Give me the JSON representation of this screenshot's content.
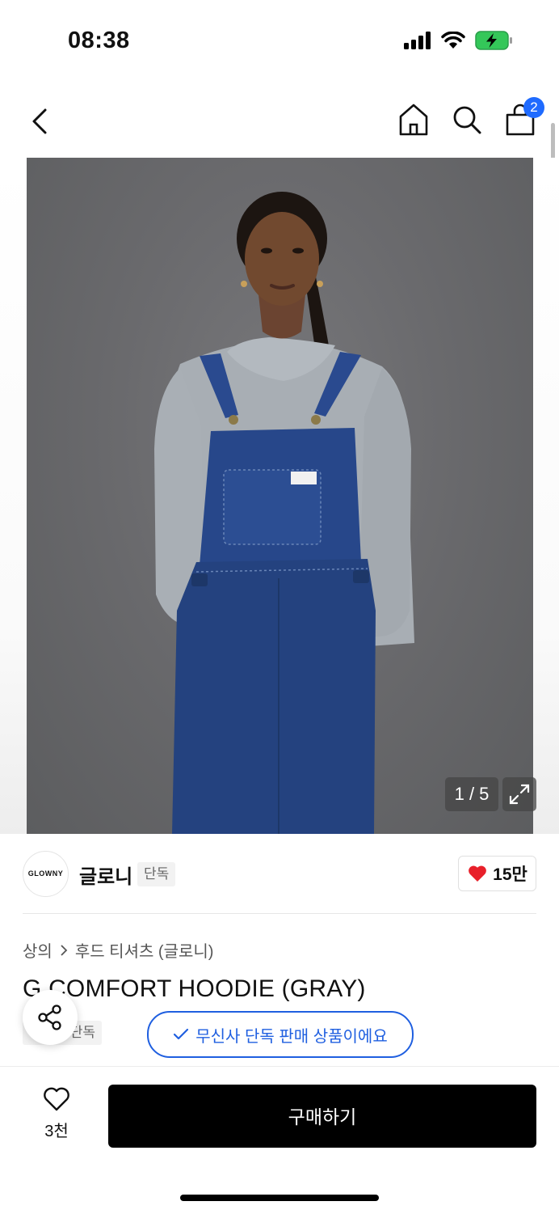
{
  "status_bar": {
    "time": "08:38"
  },
  "nav": {
    "cart_count": "2"
  },
  "gallery": {
    "counter": "1 / 5"
  },
  "brand": {
    "logo_text": "GLOWNY",
    "name": "글로니",
    "badge": "단독",
    "likes": "15만"
  },
  "breadcrumb": {
    "category": "상의",
    "subcategory": "후드 티셔츠 (글로니)"
  },
  "product": {
    "title": "G COMFORT HOODIE (GRAY)",
    "chip": "단독",
    "exclusive_message": "무신사 단독 판매 상품이에요"
  },
  "bottom_bar": {
    "wish_count": "3천",
    "buy_label": "구매하기"
  },
  "colors": {
    "accent_blue": "#1f5fe0",
    "badge_blue": "#1f6bff",
    "heart_red": "#e8202a"
  }
}
